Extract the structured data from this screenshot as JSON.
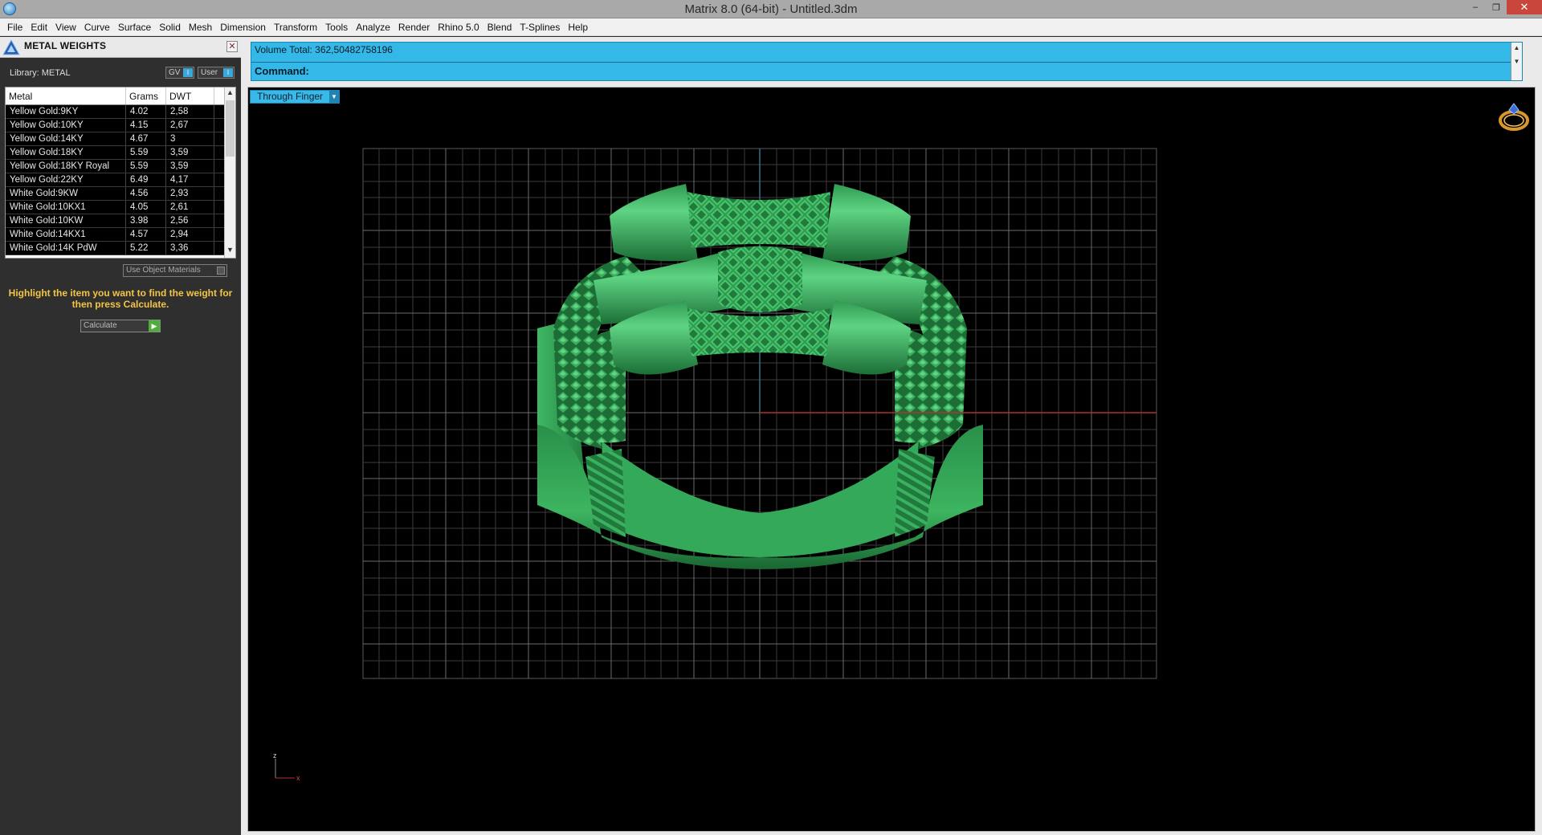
{
  "window": {
    "title": "Matrix 8.0 (64-bit) - Untitled.3dm",
    "minimize_glyph": "–",
    "restore_glyph": "❐",
    "close_glyph": "✕"
  },
  "menu": [
    "File",
    "Edit",
    "View",
    "Curve",
    "Surface",
    "Solid",
    "Mesh",
    "Dimension",
    "Transform",
    "Tools",
    "Analyze",
    "Render",
    "Rhino 5.0",
    "Blend",
    "T-Splines",
    "Help"
  ],
  "panel": {
    "title": "METAL WEIGHTS",
    "close_glyph": "✕",
    "library_label": "Library: METAL",
    "toggle_gv": "GV",
    "toggle_user": "User",
    "toggle_switch": "I",
    "columns": [
      "Metal",
      "Grams",
      "DWT"
    ],
    "rows": [
      {
        "metal": "Yellow Gold:9KY",
        "grams": "4.02",
        "dwt": "2,58"
      },
      {
        "metal": "Yellow Gold:10KY",
        "grams": "4.15",
        "dwt": "2,67"
      },
      {
        "metal": "Yellow Gold:14KY",
        "grams": "4.67",
        "dwt": "3"
      },
      {
        "metal": "Yellow Gold:18KY",
        "grams": "5.59",
        "dwt": "3,59"
      },
      {
        "metal": "Yellow Gold:18KY Royal",
        "grams": "5.59",
        "dwt": "3,59"
      },
      {
        "metal": "Yellow Gold:22KY",
        "grams": "6.49",
        "dwt": "4,17"
      },
      {
        "metal": "White Gold:9KW",
        "grams": "4.56",
        "dwt": "2,93"
      },
      {
        "metal": "White Gold:10KX1",
        "grams": "4.05",
        "dwt": "2,61"
      },
      {
        "metal": "White Gold:10KW",
        "grams": "3.98",
        "dwt": "2,56"
      },
      {
        "metal": "White Gold:14KX1",
        "grams": "4.57",
        "dwt": "2,94"
      },
      {
        "metal": "White Gold:14K PdW",
        "grams": "5.22",
        "dwt": "3,36"
      }
    ],
    "scroll_up": "▲",
    "scroll_down": "▼",
    "use_object_materials": "Use Object Materials",
    "hint": "Highlight the item you want to find the weight for then press Calculate.",
    "calculate_label": "Calculate",
    "calculate_go": "▶"
  },
  "command": {
    "volume_total": "Volume Total: 362,50482758196",
    "prompt": "Command:",
    "scroll_up": "▲",
    "scroll_down": "▼"
  },
  "viewport": {
    "view_name": "Through Finger",
    "dropdown_arrow": "▼",
    "model_color": "#2fa052",
    "grid_color": "#5a5a5a",
    "axis_x_color": "#b23030",
    "axis_y_color": "#3a7080",
    "axis_x_label": "x",
    "axis_z_label": "z"
  },
  "icons": {
    "app": "matrix-logo-icon",
    "panel_logo": "matrix-triangle-icon",
    "ring": "ring-view-icon"
  }
}
